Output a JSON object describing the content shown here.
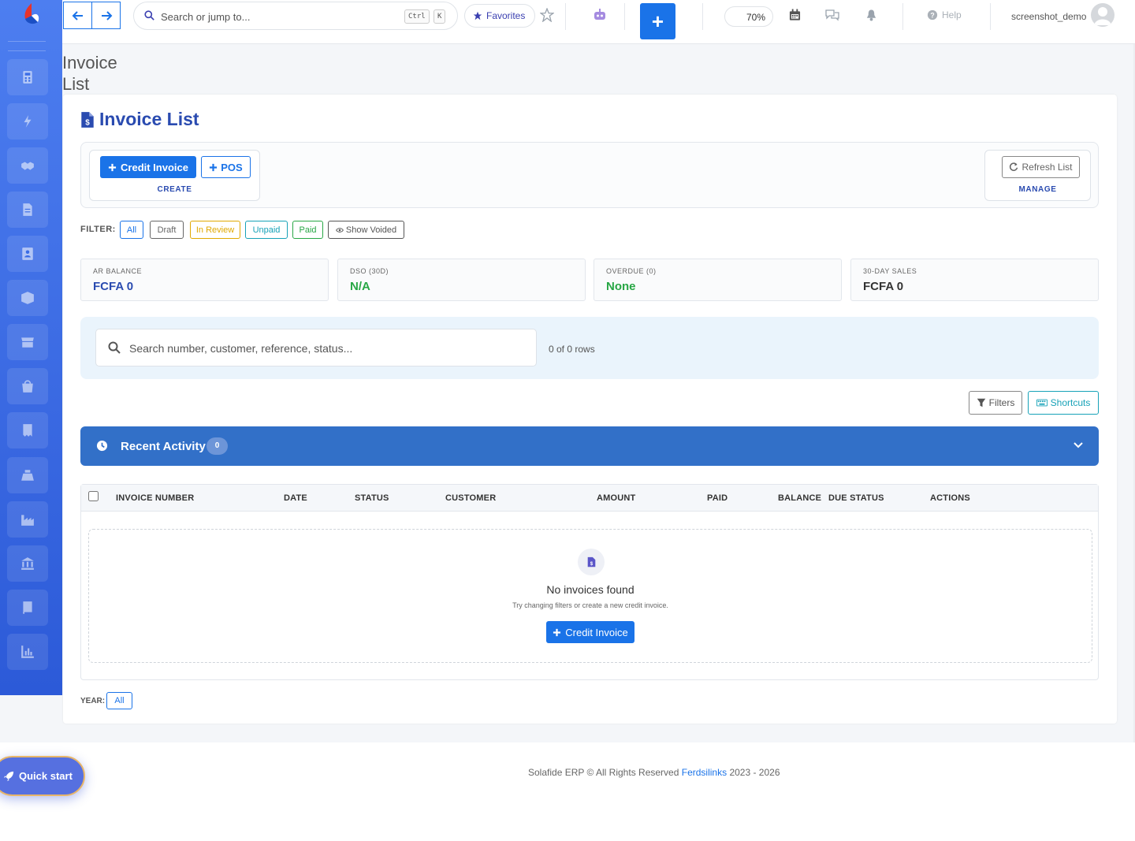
{
  "topbar": {
    "search_placeholder": "Search or jump to...",
    "kbd_ctrl": "Ctrl",
    "kbd_k": "K",
    "favorites_label": "Favorites",
    "new_label": "+",
    "zoom": "70%",
    "help_label": "Help",
    "username": "screenshot_demo"
  },
  "page": {
    "heading": "Invoice List"
  },
  "card": {
    "title": "Invoice List",
    "create_group": {
      "credit_invoice_label": "Credit Invoice",
      "pos_label": "POS",
      "caption": "CREATE"
    },
    "manage_group": {
      "refresh_label": "Refresh List",
      "caption": "MANAGE"
    }
  },
  "filters": {
    "label": "FILTER:",
    "chips": [
      {
        "label": "All",
        "color": "#1a73e8"
      },
      {
        "label": "Draft",
        "color": "#666666"
      },
      {
        "label": "In Review",
        "color": "#e0a800"
      },
      {
        "label": "Unpaid",
        "color": "#17a2b8"
      },
      {
        "label": "Paid",
        "color": "#28a745"
      },
      {
        "label": "Show Voided",
        "color": "#555555"
      }
    ]
  },
  "stats": [
    {
      "label": "AR BALANCE",
      "value": "FCFA 0",
      "color": "#2a4bb0"
    },
    {
      "label": "DSO (30D)",
      "value": "N/A",
      "color": "#28a745"
    },
    {
      "label": "OVERDUE (0)",
      "value": "None",
      "color": "#28a745"
    },
    {
      "label": "30-DAY SALES",
      "value": "FCFA 0",
      "color": "#333333"
    }
  ],
  "search": {
    "placeholder": "Search number, customer, reference, status...",
    "rows_text": "0 of 0 rows"
  },
  "tools": {
    "filters_label": "Filters",
    "shortcuts_label": "Shortcuts"
  },
  "recent_activity": {
    "title": "Recent Activity",
    "count": "0"
  },
  "table": {
    "columns": [
      "INVOICE NUMBER",
      "DATE",
      "STATUS",
      "CUSTOMER",
      "AMOUNT",
      "PAID",
      "BALANCE",
      "DUE STATUS",
      "ACTIONS"
    ],
    "empty_title": "No invoices found",
    "empty_subtitle": "Try changing filters or create a new credit invoice.",
    "empty_button": "Credit Invoice"
  },
  "year_filter": {
    "label": "YEAR:",
    "value": "All"
  },
  "footer": {
    "prefix": "Solafide ERP © All Rights Reserved",
    "link": "Ferdsilinks",
    "years": "2023 - 2026"
  },
  "quick_start": {
    "label": "Quick start"
  },
  "colors": {
    "primary": "#1a73e8",
    "sidebar": "#3b6de6",
    "recent_bar": "#3270c8"
  }
}
